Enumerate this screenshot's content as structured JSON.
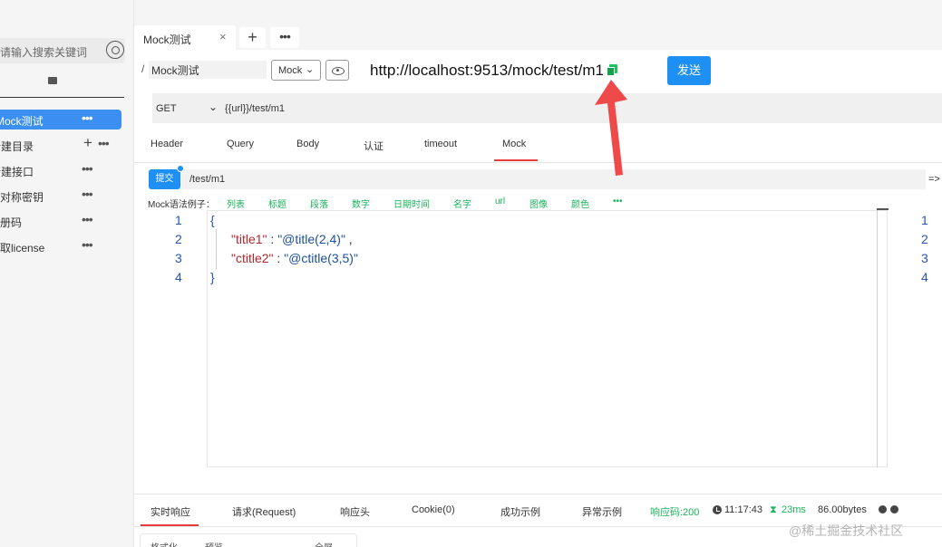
{
  "sidebar": {
    "search_placeholder": "请输入搜索关键词",
    "items": [
      {
        "label": "Mock测试",
        "active": true
      },
      {
        "label": "新建目录"
      },
      {
        "label": "新建接口"
      },
      {
        "label": "非对称密钥"
      },
      {
        "label": "注册码"
      },
      {
        "label": "获取license"
      }
    ]
  },
  "tabs": {
    "active_label": "Mock测试",
    "close": "×",
    "add": "+",
    "more": "•••"
  },
  "request": {
    "path_prefix": "/",
    "name": "Mock测试",
    "mode": "Mock",
    "mode_chevron": "⌄",
    "url": "http://localhost:9513/mock/test/m1",
    "send_label": "发送",
    "method": "GET",
    "method_chevron": "⌄",
    "url_template": "{{url}}/test/m1"
  },
  "sub_tabs": [
    "Header",
    "Query",
    "Body",
    "认证",
    "timeout",
    "Mock"
  ],
  "mock": {
    "submit_label": "提交",
    "path": "/test/m1",
    "arrow": "=>",
    "examples_label": "Mock语法例子：",
    "examples": [
      "列表",
      "标题",
      "段落",
      "数字",
      "日期时间",
      "名字",
      "url",
      "图像",
      "颜色",
      "•••"
    ]
  },
  "editor": {
    "line_numbers": [
      "1",
      "2",
      "3",
      "4"
    ],
    "lines": {
      "l1": "{",
      "l2_key": "\"title1\"",
      "l2_colon": " : ",
      "l2_val": "\"@title(2,4)\"",
      "l2_comma": " ,",
      "l3_key": "\"ctitle2\"",
      "l3_colon": " : ",
      "l3_val": "\"@ctitle(3,5)\"",
      "l4": "}"
    },
    "right_line_numbers": [
      "1",
      "2",
      "3",
      "4"
    ]
  },
  "response": {
    "tabs": [
      "实时响应",
      "请求(Request)",
      "响应头",
      "Cookie(0)",
      "成功示例",
      "异常示例"
    ],
    "status": "响应码:200",
    "time": "11:17:43",
    "duration": "23ms",
    "size": "86.00bytes"
  },
  "bottom_toolbar": [
    "格式化",
    "预览",
    "全屏"
  ],
  "watermark": "@稀土掘金技术社区",
  "colors": {
    "accent": "#1e8ff3",
    "success": "#19b35a",
    "active_tab": "#e83b3b",
    "arrow": "#ef4a4a"
  }
}
